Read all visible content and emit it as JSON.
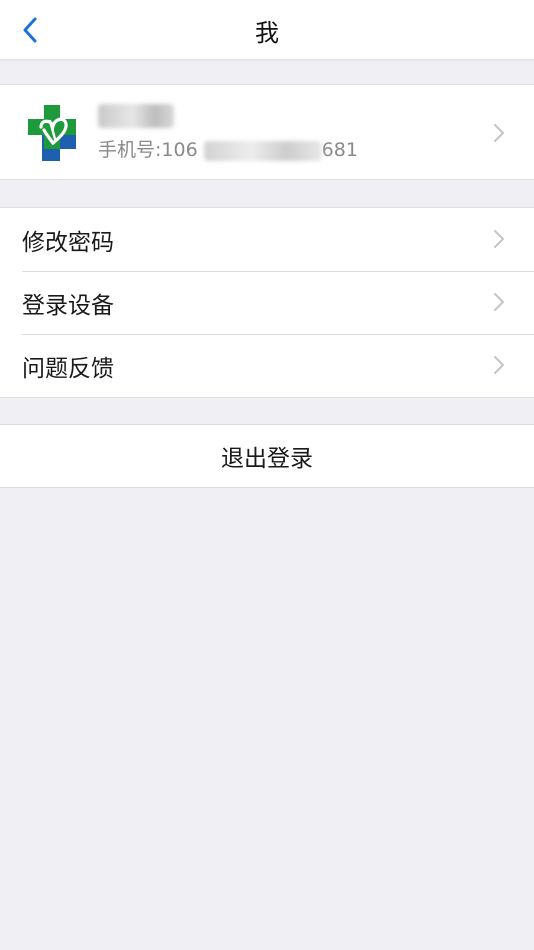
{
  "navbar": {
    "title": "我",
    "back_icon": "chevron-left-icon",
    "accent_color": "#1a73d9"
  },
  "profile": {
    "logo_icon": "medical-cross-logo",
    "name": "",
    "phone_label": "手机号:",
    "phone_visible_prefix": "106",
    "phone_visible_suffix": "681",
    "logo_colors": {
      "green": "#1e9a3c",
      "blue": "#1f5fb0"
    }
  },
  "menu": {
    "items": [
      {
        "label": "修改密码"
      },
      {
        "label": "登录设备"
      },
      {
        "label": "问题反馈"
      }
    ]
  },
  "logout": {
    "label": "退出登录"
  }
}
